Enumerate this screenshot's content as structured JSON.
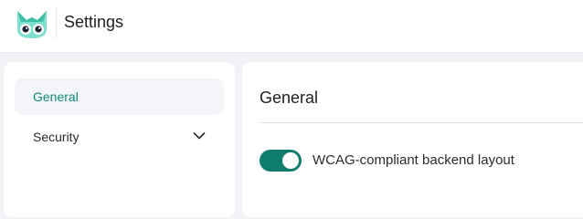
{
  "header": {
    "app_title": "Settings",
    "logo_icon": "owl-logo-icon"
  },
  "sidebar": {
    "items": [
      {
        "label": "General",
        "active": true
      },
      {
        "label": "Security",
        "active": false,
        "icon": "chevron-down-icon"
      }
    ]
  },
  "main": {
    "title": "General",
    "settings": [
      {
        "label": "WCAG-compliant backend layout",
        "enabled": true
      }
    ]
  },
  "colors": {
    "accent": "#0f7d6d",
    "active_nav_text": "#0f8a76",
    "page_background": "#f3f3f7"
  }
}
